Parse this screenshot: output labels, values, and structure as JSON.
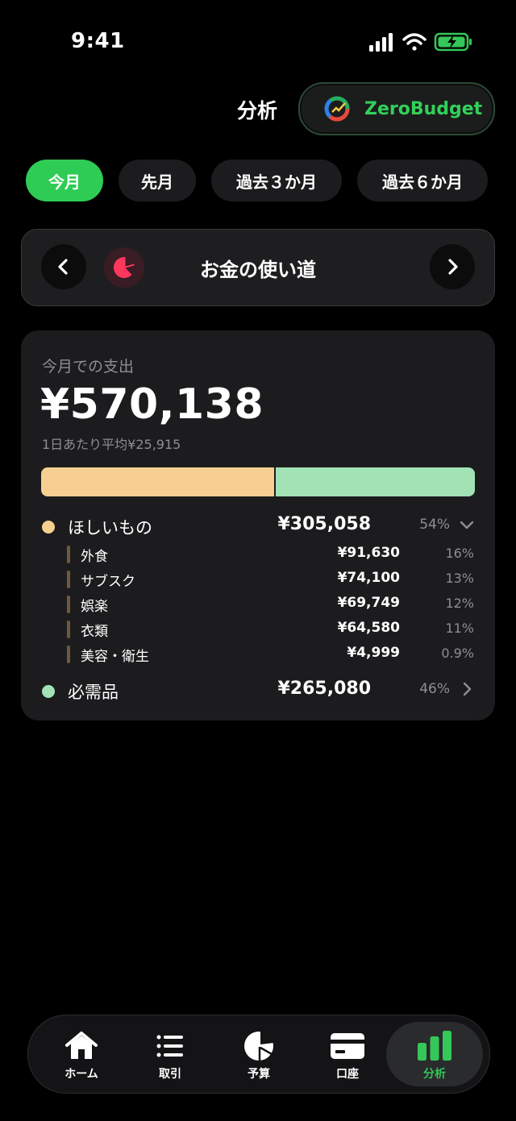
{
  "status": {
    "time": "9:41"
  },
  "header": {
    "title": "分析",
    "brand": "ZeroBudget"
  },
  "periods": [
    "今月",
    "先月",
    "過去３か月",
    "過去６か月"
  ],
  "active_period": "今月",
  "switcher": {
    "title": "お金の使い道"
  },
  "summary": {
    "label": "今月での支出",
    "total": "¥570,138",
    "daily_avg": "1日あたり平均¥25,915",
    "split": {
      "want_fraction": 0.54,
      "need_fraction": 0.46
    },
    "colors": {
      "want": "#f7cf91",
      "need": "#a1e3b5"
    }
  },
  "categories": [
    {
      "name": "ほしいもの",
      "amount": "¥305,058",
      "percent": "54%",
      "expanded": true,
      "items": [
        {
          "name": "外食",
          "amount": "¥91,630",
          "percent": "16%"
        },
        {
          "name": "サブスク",
          "amount": "¥74,100",
          "percent": "13%"
        },
        {
          "name": "娯楽",
          "amount": "¥69,749",
          "percent": "12%"
        },
        {
          "name": "衣類",
          "amount": "¥64,580",
          "percent": "11%"
        },
        {
          "name": "美容・衛生",
          "amount": "¥4,999",
          "percent": "0.9%"
        }
      ]
    },
    {
      "name": "必需品",
      "amount": "¥265,080",
      "percent": "46%",
      "expanded": false
    }
  ],
  "tabs": [
    {
      "label": "ホーム",
      "icon": "home-icon"
    },
    {
      "label": "取引",
      "icon": "list-icon"
    },
    {
      "label": "予算",
      "icon": "pie-icon"
    },
    {
      "label": "口座",
      "icon": "card-icon"
    },
    {
      "label": "分析",
      "icon": "bar-chart-icon",
      "active": true
    }
  ],
  "accent_color": "#34c759"
}
